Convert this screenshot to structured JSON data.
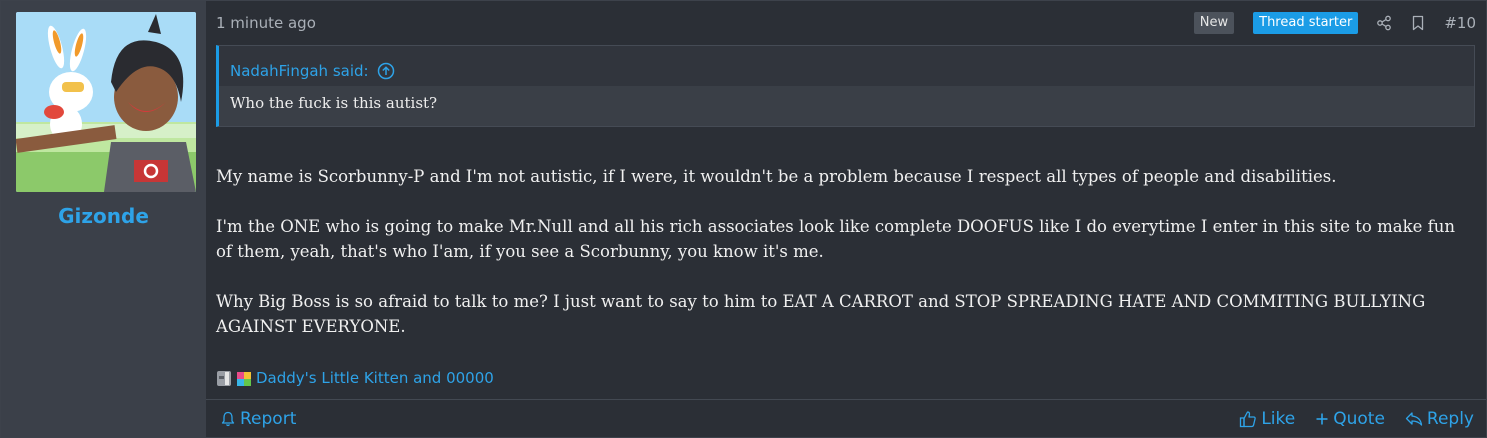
{
  "user": {
    "name": "Gizonde"
  },
  "post": {
    "time": "1 minute ago",
    "badge_new": "New",
    "badge_thread_starter": "Thread starter",
    "number": "#10",
    "quote": {
      "author": "NadahFingah said:",
      "text": "Who the fuck is this autist?"
    },
    "paragraphs": [
      "My name is Scorbunny-P and I'm not autistic, if I were, it wouldn't be a problem because I respect all types of people and disabilities.",
      "I'm the ONE who is going to make Mr.Null and all his rich associates look like complete DOOFUS like I do everytime I enter in this site to make fun of them, yeah, that's who I'am, if you see a Scorbunny, you know it's me.",
      "Why Big Boss is so afraid to talk to me? I just want to say to him to EAT A CARROT and STOP SPREADING HATE AND COMMITING BULLYING AGAINST EVERYONE."
    ],
    "reactions_text": "Daddy's Little Kitten and 00000"
  },
  "footer": {
    "report": "Report",
    "like": "Like",
    "quote": "Quote",
    "reply": "Reply"
  },
  "colors": {
    "accent": "#2ea3e8",
    "thread_starter": "#1b9ce6",
    "panel": "#2b2f36",
    "user_cell": "#3b4049"
  }
}
